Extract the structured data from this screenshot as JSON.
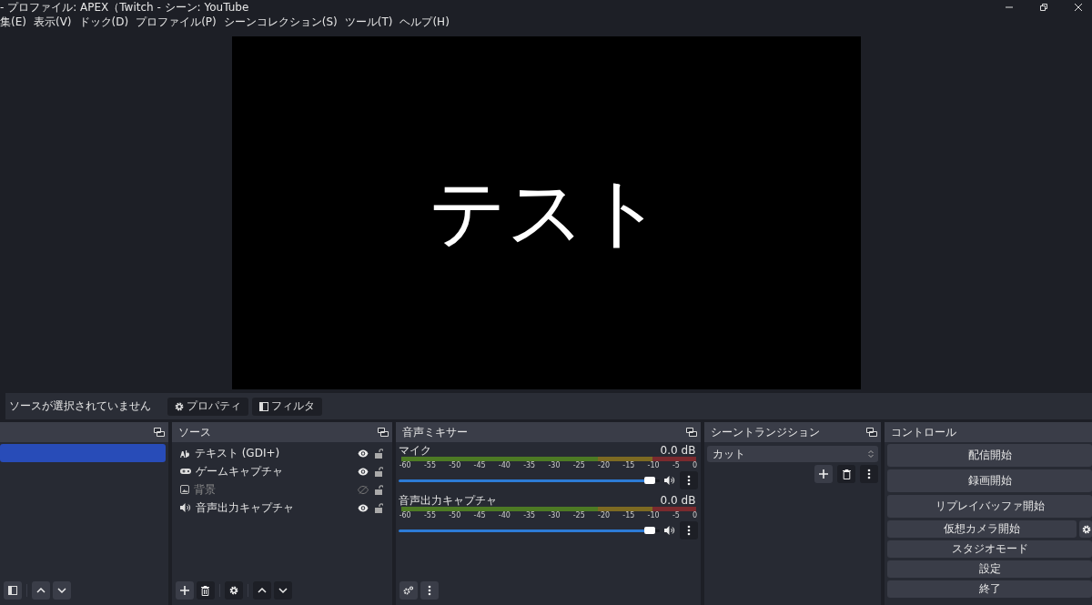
{
  "window": {
    "title": "- プロファイル: APEX（Twitch - シーン: YouTube"
  },
  "menu": [
    "集(E)",
    "表示(V)",
    "ドック(D)",
    "プロファイル(P)",
    "シーンコレクション(S)",
    "ツール(T)",
    "ヘルプ(H)"
  ],
  "preview": {
    "text": "テスト"
  },
  "context_bar": {
    "status": "ソースが選択されていません",
    "buttons": [
      {
        "label": "プロパティ",
        "kind": "properties"
      },
      {
        "label": "フィルタ",
        "kind": "filters"
      }
    ]
  },
  "scenes": {
    "items": [
      {
        "selected": true
      }
    ]
  },
  "sources": {
    "title": "ソース",
    "items": [
      {
        "name": "テキスト (GDI+)",
        "kind": "text",
        "visible": true,
        "locked": false
      },
      {
        "name": "ゲームキャプチャ",
        "kind": "game",
        "visible": true,
        "locked": false
      },
      {
        "name": "背景",
        "kind": "image",
        "visible": false,
        "locked": false
      },
      {
        "name": "音声出力キャプチャ",
        "kind": "audio",
        "visible": true,
        "locked": false
      }
    ]
  },
  "mixer": {
    "title": "音声ミキサー",
    "channels": [
      {
        "name": "マイク",
        "reading": "0.0 dB",
        "level": 0.98,
        "muted": false,
        "ticks": [
          "-60",
          "-55",
          "-50",
          "-45",
          "-40",
          "-35",
          "-30",
          "-25",
          "-20",
          "-15",
          "-10",
          "-5",
          "0"
        ]
      },
      {
        "name": "音声出力キャプチャ",
        "reading": "0.0 dB",
        "level": 0.98,
        "muted": false,
        "ticks": [
          "-60",
          "-55",
          "-50",
          "-45",
          "-40",
          "-35",
          "-30",
          "-25",
          "-20",
          "-15",
          "-10",
          "-5",
          "0"
        ]
      }
    ]
  },
  "transitions": {
    "title": "シーントランジション",
    "selected": "カット"
  },
  "controls": {
    "title": "コントロール",
    "buttons": [
      {
        "label": "配信開始",
        "kind": "tall"
      },
      {
        "label": "録画開始",
        "kind": "tall"
      },
      {
        "label": "リプレイバッファ開始",
        "kind": "tall"
      },
      {
        "label": "仮想カメラ開始",
        "kind": "with-settings"
      },
      {
        "label": "スタジオモード",
        "kind": "short"
      },
      {
        "label": "設定",
        "kind": "short"
      },
      {
        "label": "終了",
        "kind": "short"
      }
    ]
  }
}
